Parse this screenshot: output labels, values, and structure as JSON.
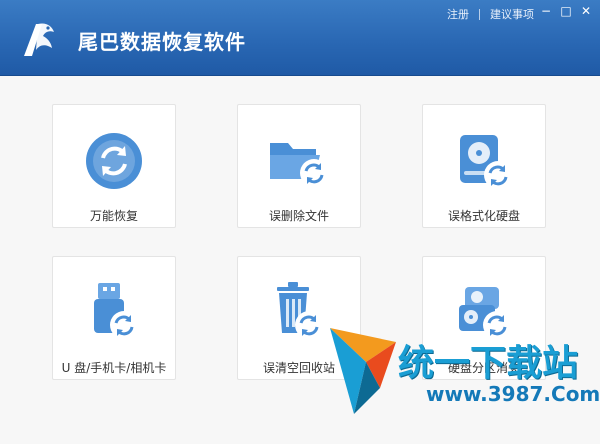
{
  "app": {
    "title": "尾巴数据恢复软件",
    "links": {
      "register": "注册",
      "suggest": "建议事项"
    },
    "controls": {
      "minimize": "−",
      "maximize": "□",
      "close": "✕"
    }
  },
  "colors": {
    "header": "#2a68b4",
    "icon_blue": "#4a8fd6",
    "icon_light": "#7ab2e9"
  },
  "tiles": [
    {
      "label": "万能恢复",
      "icon": "sync-circle-icon"
    },
    {
      "label": "误删除文件",
      "icon": "folder-sync-icon"
    },
    {
      "label": "误格式化硬盘",
      "icon": "hdd-sync-icon"
    },
    {
      "label": "U 盘/手机卡/相机卡",
      "icon": "usb-sync-icon"
    },
    {
      "label": "误清空回收站",
      "icon": "trash-sync-icon"
    },
    {
      "label": "硬盘分区消失",
      "icon": "partition-sync-icon"
    }
  ],
  "watermark": {
    "brand": "统一下载站",
    "url": "www.3987.Com"
  }
}
